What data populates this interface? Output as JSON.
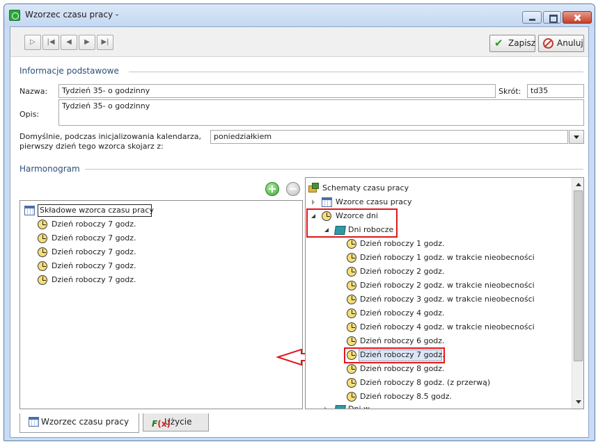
{
  "window": {
    "title": "Wzorzec czasu pracy -"
  },
  "toolbar": {
    "nav": [
      "▷",
      "|◀",
      "◀",
      "▶",
      "▶|"
    ],
    "save_label": "Zapisz",
    "cancel_label": "Anuluj"
  },
  "basic_info": {
    "section_title": "Informacje podstawowe",
    "name_label": "Nazwa:",
    "name_value": "Tydzień 35- o godzinny",
    "short_label": "Skrót:",
    "short_value": "td35",
    "desc_label": "Opis:",
    "desc_value": "Tydzień 35- o godzinny",
    "default_label_line1": "Domyślnie, podczas inicjalizowania kalendarza,",
    "default_label_line2": "pierwszy dzień tego wzorca skojarz z:",
    "default_value": "poniedziałkiem"
  },
  "schedule": {
    "section_title": "Harmonogram",
    "left_tree": {
      "root": "Składowe wzorca czasu pracy",
      "items": [
        "Dzień roboczy 7 godz.",
        "Dzień roboczy 7 godz.",
        "Dzień roboczy 7 godz.",
        "Dzień roboczy 7 godz.",
        "Dzień roboczy 7 godz."
      ]
    },
    "right_tree": {
      "root": "Schematy czasu pracy",
      "week_patterns": "Wzorce czasu pracy",
      "day_patterns": "Wzorce dni",
      "work_days": "Dni robocze",
      "items": [
        "Dzień roboczy 1 godz.",
        "Dzień roboczy 1 godz. w trakcie nieobecności",
        "Dzień roboczy 2 godz.",
        "Dzień roboczy 2 godz. w trakcie nieobecności",
        "Dzień roboczy 3 godz. w trakcie nieobecności",
        "Dzień roboczy 4 godz.",
        "Dzień roboczy 4 godz. w trakcie nieobecności",
        "Dzień roboczy 6 godz.",
        "Dzień roboczy 7 godz.",
        "Dzień roboczy 8 godz.",
        "Dzień roboczy 8 godz. (z przerwą)",
        "Dzień roboczy 8.5 godz."
      ],
      "partial_next": "Dni w...",
      "selected_index": 8
    },
    "colors": {
      "highlight_box": "#e0161b",
      "section_title": "#2a4d7a"
    }
  },
  "tabs": [
    {
      "label": "Wzorzec czasu pracy",
      "icon": "calendar-icon",
      "active": true
    },
    {
      "label": "Użycie",
      "icon": "function-icon",
      "active": false
    }
  ]
}
